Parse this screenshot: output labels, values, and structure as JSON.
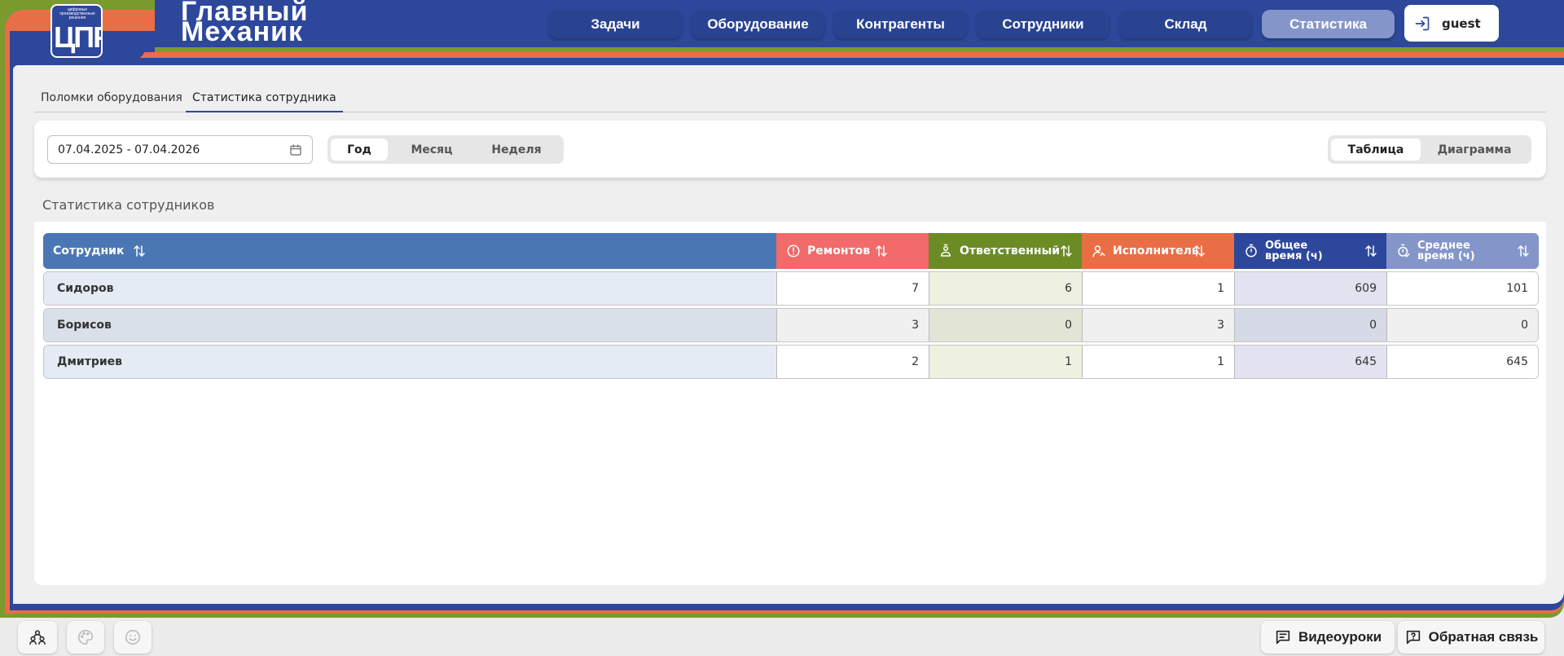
{
  "logo": {
    "small_text": "цифровые производственные решения",
    "mark": "ЦПР"
  },
  "brand": {
    "line1": "Главный",
    "line2": "Механик"
  },
  "nav": {
    "items": [
      "Задачи",
      "Оборудование",
      "Контрагенты",
      "Сотрудники",
      "Склад",
      "Статистика"
    ],
    "active": "Статистика"
  },
  "user": {
    "name": "guest",
    "icon": "login-icon"
  },
  "subtabs": {
    "items": [
      "Поломки оборудования",
      "Статистика сотрудника"
    ],
    "active": "Статистика сотрудника"
  },
  "filters": {
    "date_range": "07.04.2025 - 07.04.2026",
    "period": {
      "options": [
        "Год",
        "Месяц",
        "Неделя"
      ],
      "selected": "Год"
    },
    "view": {
      "options": [
        "Таблица",
        "Диаграмма"
      ],
      "selected": "Таблица"
    }
  },
  "panel": {
    "title": "Статистика сотрудников"
  },
  "table": {
    "columns": [
      {
        "label": "Сотрудник",
        "icon": ""
      },
      {
        "label": "Ремонтов",
        "icon": "alert-circle-icon",
        "color": "#f26a6a"
      },
      {
        "label": "Ответственный",
        "icon": "person-badge-icon",
        "color": "#6b8c25"
      },
      {
        "label": "Исполнитель",
        "icon": "person-wrench-icon",
        "color": "#ea6e45"
      },
      {
        "label": "Общее время (ч)",
        "line1": "Общее",
        "line2": "время (ч)",
        "icon": "stopwatch-icon",
        "color": "#2d479b"
      },
      {
        "label": "Среднее время (ч)",
        "line1": "Среднее",
        "line2": "время (ч)",
        "icon": "stopwatch-check-icon",
        "color": "#8496c9"
      }
    ],
    "name_col_color": "#4a77b4",
    "rows": [
      {
        "name": "Сидоров",
        "repairs": "7",
        "responsible": "6",
        "executor": "1",
        "total_time": "609",
        "avg_time": "101"
      },
      {
        "name": "Борисов",
        "repairs": "3",
        "responsible": "0",
        "executor": "3",
        "total_time": "0",
        "avg_time": "0"
      },
      {
        "name": "Дмитриев",
        "repairs": "2",
        "responsible": "1",
        "executor": "1",
        "total_time": "645",
        "avg_time": "645"
      }
    ]
  },
  "footer": {
    "left_icons": [
      "people-icon",
      "palette-icon",
      "smile-icon"
    ],
    "video_lessons": "Видеоуроки",
    "feedback": "Обратная связь"
  }
}
